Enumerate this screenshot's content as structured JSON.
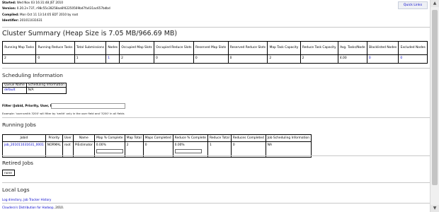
{
  "header": {
    "started_label": "Started:",
    "started_value": "Wed Nov 03 16:31:48 JST 2010",
    "version_label": "Version:",
    "version_value": "0.20.2+737, r98c55c28258aa6f42250569bd7fa431ac657bdbd",
    "compiled_label": "Compiled:",
    "compiled_value": "Mon Oct 11 13:14:05 EDT 2010 by root",
    "identifier_label": "Identifier:",
    "identifier_value": "201011031631",
    "quick_links": "Quick Links"
  },
  "cluster_summary": {
    "title": "Cluster Summary (Heap Size is 7.05 MB/966.69 MB)",
    "headers": [
      "Running Map Tasks",
      "Running Reduce Tasks",
      "Total Submissions",
      "Nodes",
      "Occupied Map Slots",
      "Occupied Reduce Slots",
      "Reserved Map Slots",
      "Reserved Reduce Slots",
      "Map Task Capacity",
      "Reduce Task Capacity",
      "Avg. Tasks/Node",
      "Blacklisted Nodes",
      "Excluded Nodes"
    ],
    "values": [
      "2",
      "0",
      "1",
      "1",
      "2",
      "0",
      "0",
      "0",
      "2",
      "2",
      "4.00",
      "0",
      "0"
    ]
  },
  "scheduling": {
    "title": "Scheduling Information",
    "headers": [
      "Queue Name",
      "Scheduling Information"
    ],
    "rows": [
      [
        "default",
        "N/A"
      ]
    ]
  },
  "filter": {
    "label": "Filter (Jobid, Priority, User, Name)",
    "value": "",
    "help": "Example: 'user:smith 3200' will filter by 'smith' only in the user field and '3200' in all fields"
  },
  "running_jobs": {
    "title": "Running Jobs",
    "headers": [
      "Jobid",
      "Priority",
      "User",
      "Name",
      "Map % Complete",
      "Map Total",
      "Maps Completed",
      "Reduce % Complete",
      "Reduce Total",
      "Reduces Completed",
      "Job Scheduling Information"
    ],
    "rows": [
      {
        "jobid": "job_201011031631_0001",
        "priority": "NORMAL",
        "user": "root",
        "name": "PiEstimator",
        "map_pct_text": "0.00%",
        "map_pct": 0,
        "map_total": "2",
        "maps_completed": "0",
        "reduce_pct_text": "0.00%",
        "reduce_pct": 0,
        "reduce_total": "1",
        "reduces_completed": "0",
        "sched_info": "NA"
      }
    ]
  },
  "retired_jobs": {
    "title": "Retired Jobs",
    "value": "none"
  },
  "local_logs": {
    "title": "Local Logs",
    "prefix": "Log directory, ",
    "link": "Job Tracker History"
  },
  "footer": {
    "link": "Cloudera's Distribution for Hadoop",
    "suffix": ", 2010."
  }
}
